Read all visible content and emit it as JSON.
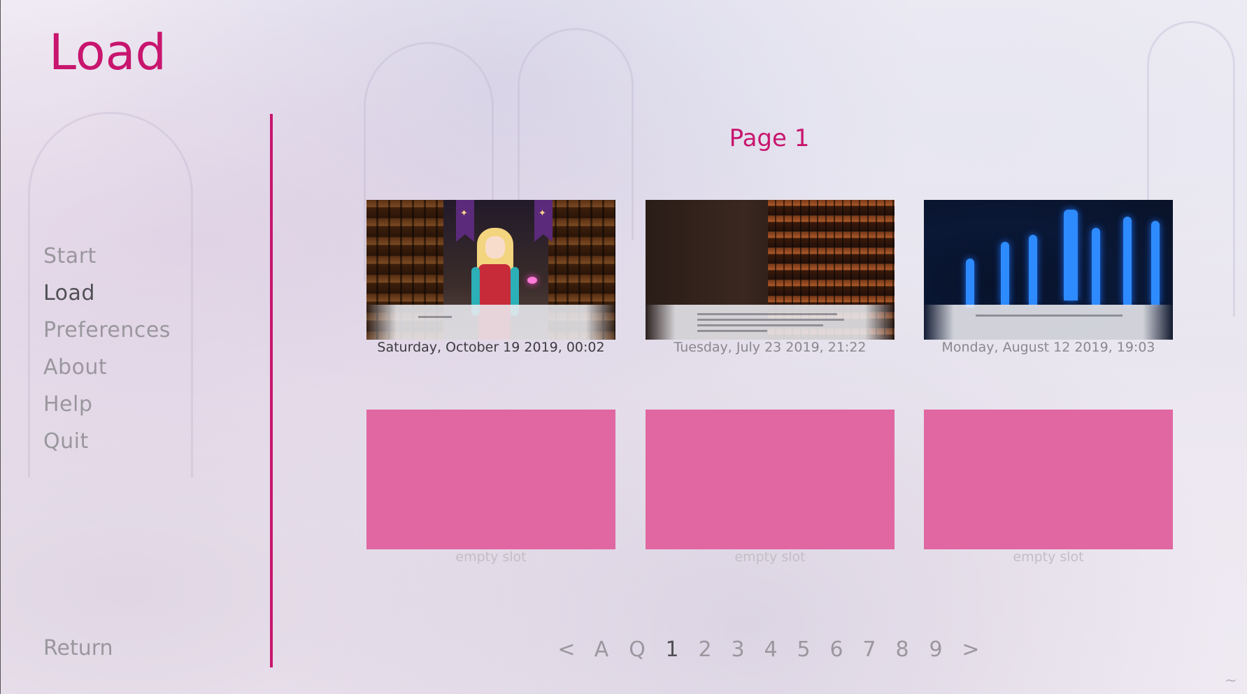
{
  "screen": {
    "title": "Load",
    "page_title": "Page 1"
  },
  "nav": {
    "items": [
      {
        "label": "Start",
        "active": false
      },
      {
        "label": "Load",
        "active": true
      },
      {
        "label": "Preferences",
        "active": false
      },
      {
        "label": "About",
        "active": false
      },
      {
        "label": "Help",
        "active": false
      },
      {
        "label": "Quit",
        "active": false
      }
    ],
    "return_label": "Return"
  },
  "slots": [
    {
      "label": "Saturday, October 19 2019, 00:02",
      "empty": false,
      "scene": "library-with-character",
      "highlighted": true
    },
    {
      "label": "Tuesday, July 23 2019, 21:22",
      "empty": false,
      "scene": "dark-room-library",
      "highlighted": false
    },
    {
      "label": "Monday, August 12 2019, 19:03",
      "empty": false,
      "scene": "blue-cathedral",
      "highlighted": false
    },
    {
      "label": "empty slot",
      "empty": true
    },
    {
      "label": "empty slot",
      "empty": true
    },
    {
      "label": "empty slot",
      "empty": true
    }
  ],
  "pager": {
    "prev": "<",
    "auto": "A",
    "quick": "Q",
    "pages": [
      "1",
      "2",
      "3",
      "4",
      "5",
      "6",
      "7",
      "8",
      "9"
    ],
    "current": "1",
    "next": ">"
  },
  "colors": {
    "accent": "#c8156e",
    "empty_slot": "#e067a2",
    "nav_idle": "#9a979e",
    "nav_active": "#505055"
  }
}
